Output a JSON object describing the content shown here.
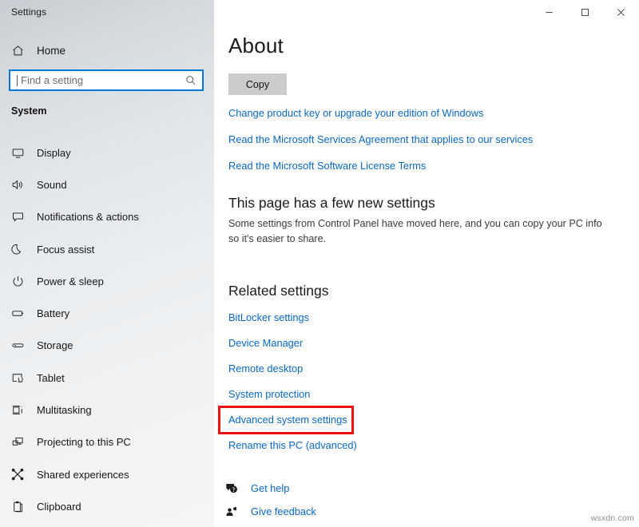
{
  "window": {
    "title": "Settings",
    "controls": [
      {
        "name": "minimize",
        "glyph": "minimize-icon"
      },
      {
        "name": "maximize",
        "glyph": "maximize-icon"
      },
      {
        "name": "close",
        "glyph": "close-icon"
      }
    ]
  },
  "sidebar": {
    "home": {
      "label": "Home",
      "icon": "home-icon"
    },
    "search": {
      "value": "",
      "placeholder": "Find a setting",
      "icon": "search-icon"
    },
    "group_label": "System",
    "items": [
      {
        "label": "Display",
        "icon": "monitor-icon"
      },
      {
        "label": "Sound",
        "icon": "speaker-icon"
      },
      {
        "label": "Notifications & actions",
        "icon": "notification-icon"
      },
      {
        "label": "Focus assist",
        "icon": "moon-icon"
      },
      {
        "label": "Power & sleep",
        "icon": "power-icon"
      },
      {
        "label": "Battery",
        "icon": "battery-icon"
      },
      {
        "label": "Storage",
        "icon": "storage-icon"
      },
      {
        "label": "Tablet",
        "icon": "tablet-icon"
      },
      {
        "label": "Multitasking",
        "icon": "multitasking-icon"
      },
      {
        "label": "Projecting to this PC",
        "icon": "projecting-icon"
      },
      {
        "label": "Shared experiences",
        "icon": "share-icon"
      },
      {
        "label": "Clipboard",
        "icon": "clipboard-icon"
      }
    ]
  },
  "main": {
    "title": "About",
    "copy_button": "Copy",
    "top_links": [
      "Change product key or upgrade your edition of Windows",
      "Read the Microsoft Services Agreement that applies to our services",
      "Read the Microsoft Software License Terms"
    ],
    "new_settings": {
      "heading": "This page has a few new settings",
      "body": "Some settings from Control Panel have moved here, and you can copy your PC info so it's easier to share."
    },
    "related": {
      "heading": "Related settings",
      "links": [
        {
          "label": "BitLocker settings",
          "highlighted": false
        },
        {
          "label": "Device Manager",
          "highlighted": false
        },
        {
          "label": "Remote desktop",
          "highlighted": false
        },
        {
          "label": "System protection",
          "highlighted": false
        },
        {
          "label": "Advanced system settings",
          "highlighted": true
        },
        {
          "label": "Rename this PC (advanced)",
          "highlighted": false
        }
      ]
    },
    "footer_links": [
      {
        "label": "Get help",
        "icon": "help-bubble-icon"
      },
      {
        "label": "Give feedback",
        "icon": "feedback-person-icon"
      }
    ]
  },
  "watermark": "wsxdn.com",
  "colors": {
    "link": "#0a67c2",
    "highlight_box": "#ee1111",
    "search_focus": "#0078d7",
    "button_face": "#cccccc"
  }
}
